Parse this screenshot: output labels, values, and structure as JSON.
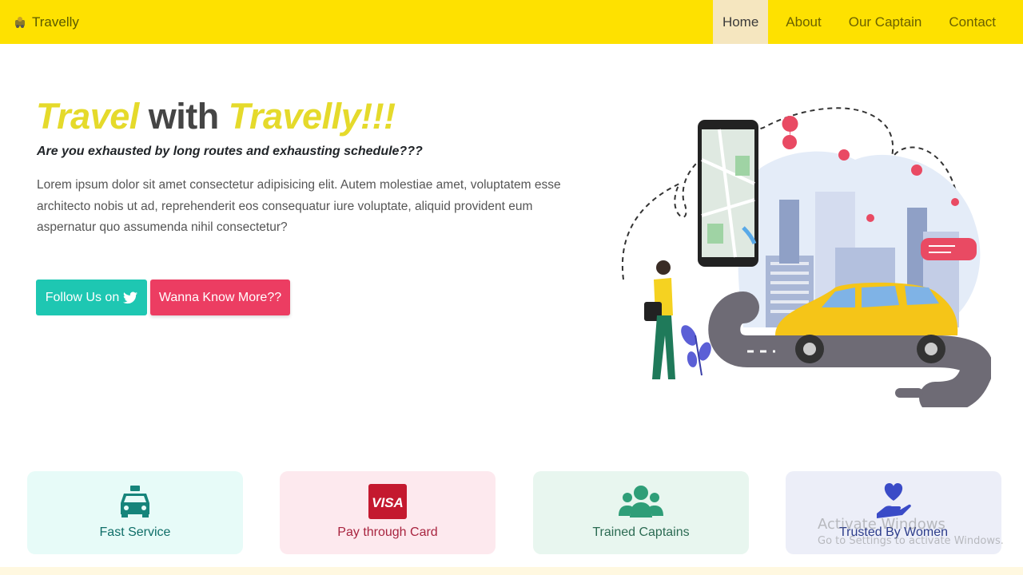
{
  "navbar": {
    "brand": "Travelly",
    "links": [
      "Home",
      "About",
      "Our Captain",
      "Contact"
    ],
    "active": "Home",
    "bg_color": "#fee100"
  },
  "hero": {
    "title_word1": "Travel",
    "title_word2": "with",
    "title_word3": "Travelly!!!",
    "subtitle": "Are you exhausted by long routes and exhausting schedule???",
    "text": "Lorem ipsum dolor sit amet consectetur adipisicing elit. Autem molestiae amet, voluptatem esse architecto nobis ut ad, reprehenderit eos consequatur iure voluptate, aliquid provident eum aspernatur quo assumenda nihil consectetur?",
    "follow_button": "Follow Us on",
    "follow_icon": "twitter-icon",
    "more_button": "Wanna Know More??",
    "accent_color": "#e5da2b"
  },
  "features": [
    {
      "label": "Fast Service",
      "icon": "taxi-icon"
    },
    {
      "label": "Pay through Card",
      "icon": "visa-card-icon"
    },
    {
      "label": "Trained Captains",
      "icon": "users-icon"
    },
    {
      "label": "Trusted By Women",
      "icon": "heart-hand-icon"
    }
  ],
  "watermark": {
    "line1": "Activate Windows",
    "line2": "Go to Settings to activate Windows."
  }
}
